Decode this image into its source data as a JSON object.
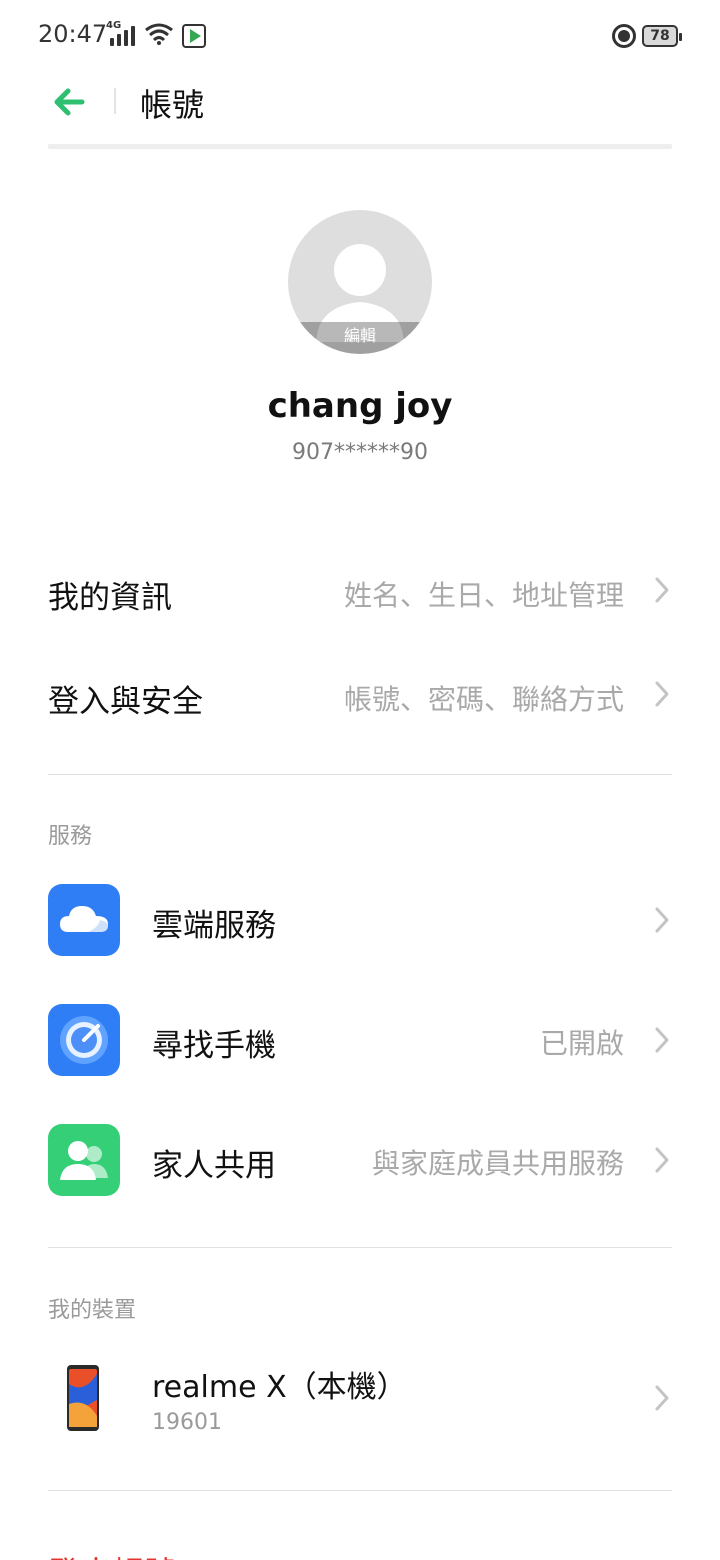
{
  "status_bar": {
    "time": "20:47",
    "network": "4G",
    "battery": "78"
  },
  "header": {
    "title": "帳號"
  },
  "profile": {
    "edit_label": "編輯",
    "name": "chang joy",
    "phone": "907******90"
  },
  "account_rows": [
    {
      "label": "我的資訊",
      "value": "姓名、生日、地址管理"
    },
    {
      "label": "登入與安全",
      "value": "帳號、密碼、聯絡方式"
    }
  ],
  "services": {
    "section_title": "服務",
    "items": [
      {
        "label": "雲端服務",
        "value": "",
        "icon": "cloud-icon",
        "color": "#2f7ef5"
      },
      {
        "label": "尋找手機",
        "value": "已開啟",
        "icon": "find-phone-icon",
        "color": "#2f7ef5"
      },
      {
        "label": "家人共用",
        "value": "與家庭成員共用服務",
        "icon": "family-icon",
        "color": "#35cf78"
      }
    ]
  },
  "devices": {
    "section_title": "我的裝置",
    "items": [
      {
        "name": "realme X（本機）",
        "sub": "19601"
      }
    ]
  },
  "logout_label": "登出帳號",
  "colors": {
    "accent": "#2fbf71",
    "danger": "#e3342f"
  }
}
